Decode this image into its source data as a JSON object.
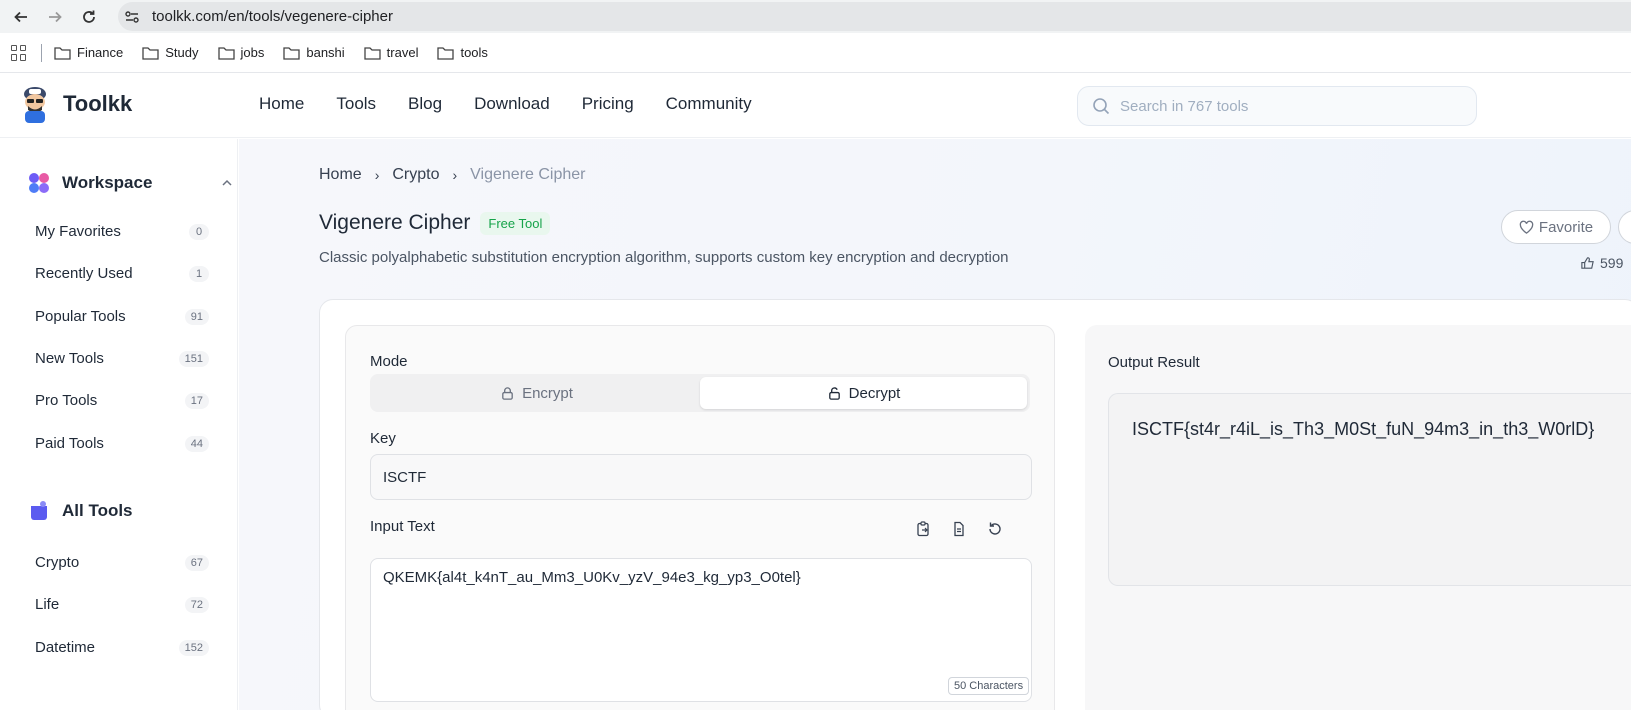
{
  "browser": {
    "url": "toolkk.com/en/tools/vegenere-cipher",
    "bookmarks": [
      "Finance",
      "Study",
      "jobs",
      "banshi",
      "travel",
      "tools"
    ]
  },
  "site": {
    "brand": "Toolkk",
    "nav": [
      "Home",
      "Tools",
      "Blog",
      "Download",
      "Pricing",
      "Community"
    ],
    "search_placeholder": "Search in 767 tools"
  },
  "sidebar": {
    "workspace_title": "Workspace",
    "workspace_items": [
      {
        "label": "My Favorites",
        "count": "0"
      },
      {
        "label": "Recently Used",
        "count": "1"
      },
      {
        "label": "Popular Tools",
        "count": "91"
      },
      {
        "label": "New Tools",
        "count": "151"
      },
      {
        "label": "Pro Tools",
        "count": "17"
      },
      {
        "label": "Paid Tools",
        "count": "44"
      }
    ],
    "all_tools_title": "All Tools",
    "category_items": [
      {
        "label": "Crypto",
        "count": "67"
      },
      {
        "label": "Life",
        "count": "72"
      },
      {
        "label": "Datetime",
        "count": "152"
      }
    ]
  },
  "breadcrumb": [
    "Home",
    "Crypto",
    "Vigenere Cipher"
  ],
  "tool": {
    "title": "Vigenere Cipher",
    "badge": "Free Tool",
    "description": "Classic polyalphabetic substitution encryption algorithm, supports custom key encryption and decryption",
    "favorite_label": "Favorite",
    "likes": "599"
  },
  "form": {
    "mode_label": "Mode",
    "mode_encrypt": "Encrypt",
    "mode_decrypt": "Decrypt",
    "selected_mode": "Decrypt",
    "key_label": "Key",
    "key_value": "ISCTF",
    "input_label": "Input Text",
    "input_value": "QKEMK{al4t_k4nT_au_Mm3_U0Kv_yzV_94e3_kg_yp3_O0tel}",
    "char_count": "50 Characters",
    "output_label": "Output Result",
    "output_value": "ISCTF{st4r_r4iL_is_Th3_M0St_fuN_94m3_in_th3_W0rlD}"
  },
  "colors": {
    "badge_green": "#16a34a",
    "workspace_icon": "#6d5cf6",
    "all_tools_icon": "#5b5bf0"
  }
}
